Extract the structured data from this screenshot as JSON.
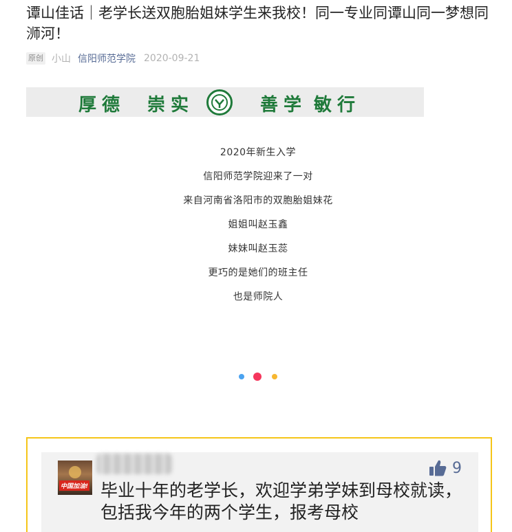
{
  "article": {
    "title": "谭山佳话｜老学长送双胞胎姐妹学生来我校！同一专业同谭山同一梦想同浉河！",
    "badge": "原创",
    "author": "小山",
    "account": "信阳师范学院",
    "date": "2020-09-21"
  },
  "banner": {
    "words": [
      "厚德",
      "崇实",
      "善学",
      "敏行"
    ],
    "emblem_icon": "university-emblem-icon",
    "color": "#1f7a3a"
  },
  "poem": {
    "lines": [
      "2020年新生入学",
      "信阳师范学院迎来了一对",
      "来自河南省洛阳市的双胞胎姐妹花",
      "姐姐叫赵玉鑫",
      "妹妹叫赵玉蕊",
      "更巧的是她们的班主任",
      "也是师院人"
    ]
  },
  "carousel_dots": {
    "colors": [
      "#4ba3f0",
      "#f5365c",
      "#f7b731"
    ]
  },
  "comment": {
    "avatar_tag": "中国加油!",
    "likes": "9",
    "like_icon": "thumbs-up-icon",
    "text": "毕业十年的老学长，欢迎学弟学妹到母校就读，包括我今年的两个学生，报考母校"
  }
}
